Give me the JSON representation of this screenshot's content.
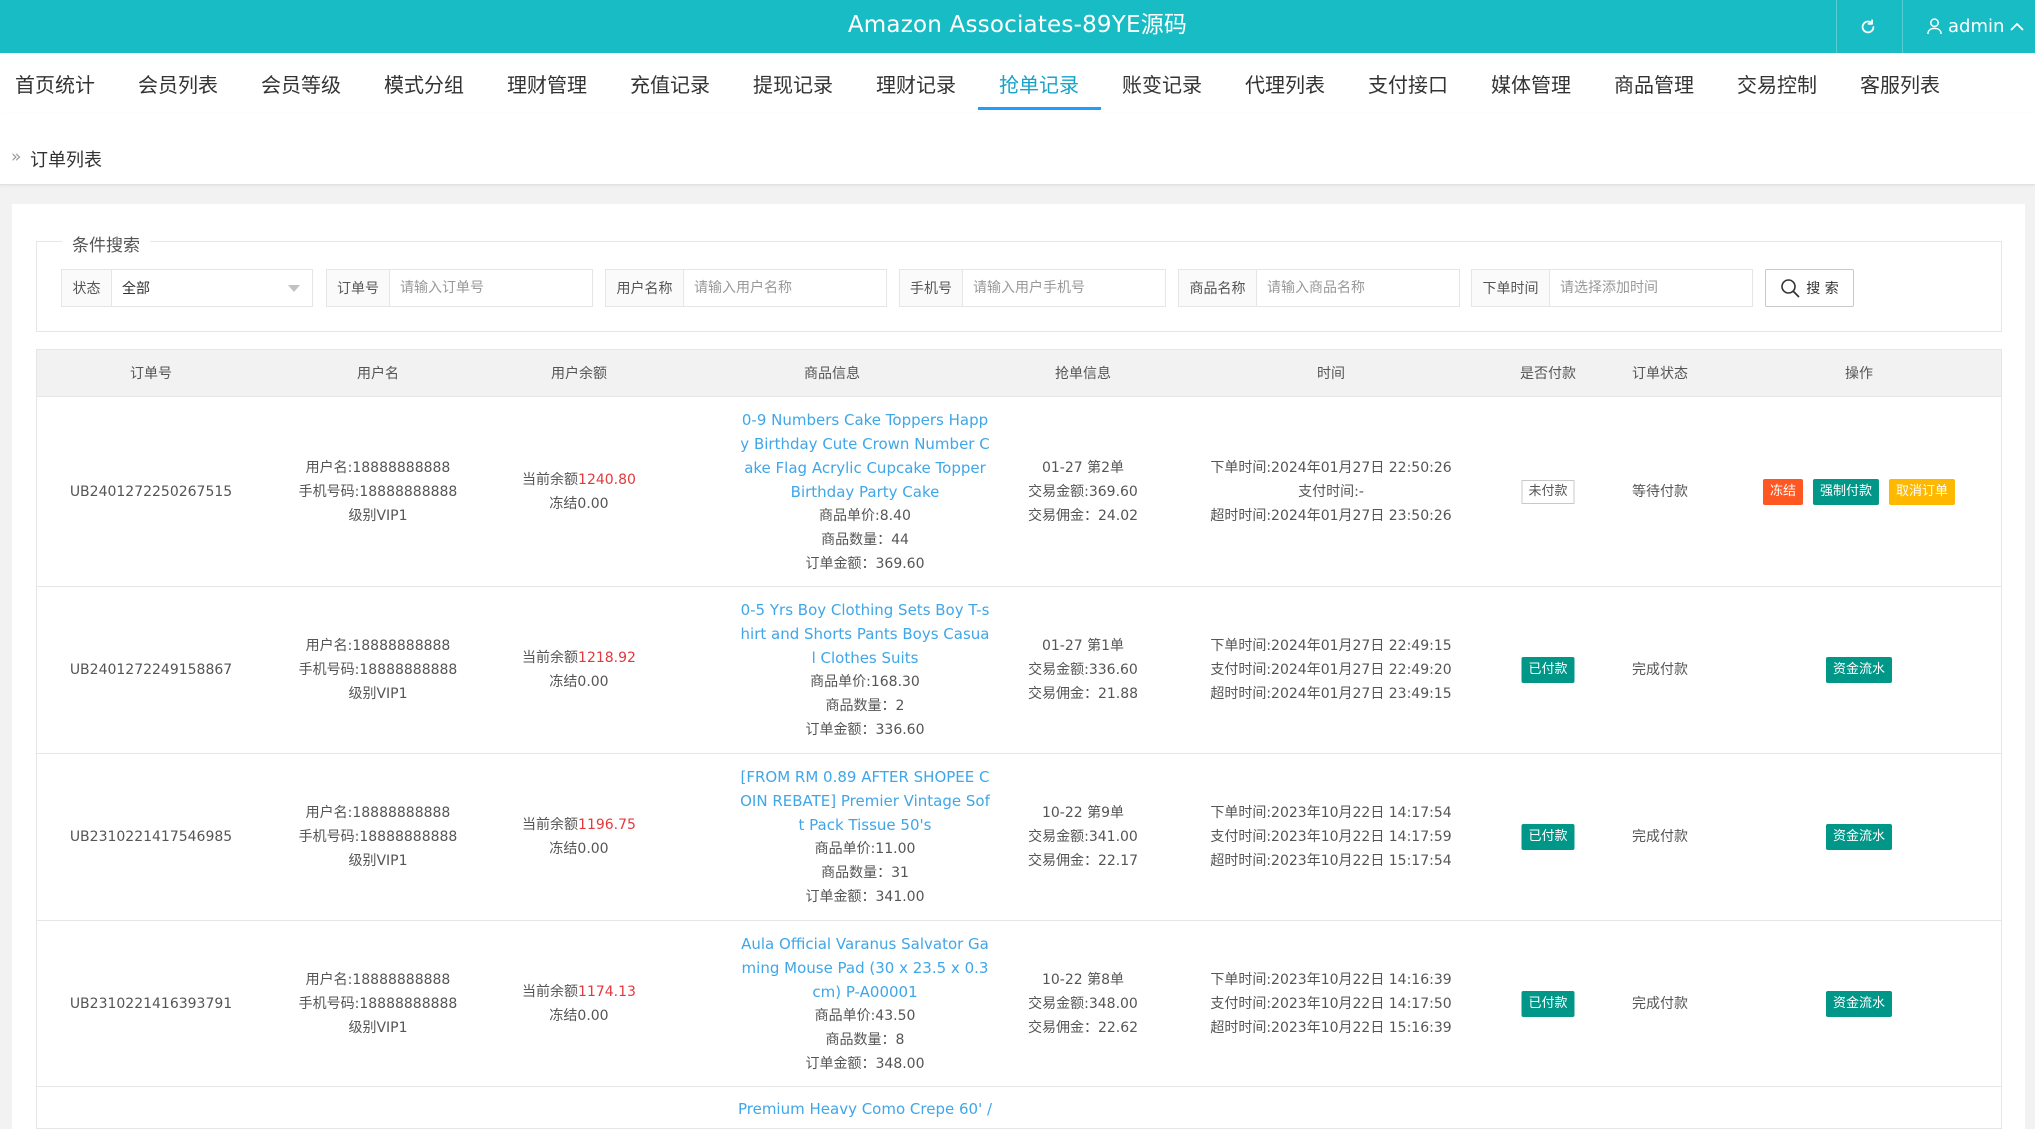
{
  "header": {
    "title": "Amazon Associates-89YE源码",
    "user": "admin",
    "bg": "#17bcc4"
  },
  "nav": {
    "items": [
      "首页统计",
      "会员列表",
      "会员等级",
      "模式分组",
      "理财管理",
      "充值记录",
      "提现记录",
      "理财记录",
      "抢单记录",
      "账变记录",
      "代理列表",
      "支付接口",
      "媒体管理",
      "商品管理",
      "交易控制",
      "客服列表"
    ],
    "active_index": 8
  },
  "breadcrumb": "订单列表",
  "search": {
    "legend": "条件搜索",
    "status_label": "状态",
    "status_value": "全部",
    "order_label": "订单号",
    "order_placeholder": "请输入订单号",
    "username_label": "用户名称",
    "username_placeholder": "请输入用户名称",
    "phone_label": "手机号",
    "phone_placeholder": "请输入用户手机号",
    "goods_label": "商品名称",
    "goods_placeholder": "请输入商品名称",
    "time_label": "下单时间",
    "time_placeholder": "请选择添加时间",
    "button": "搜 索"
  },
  "table": {
    "headers": [
      "订单号",
      "用户名",
      "用户余额",
      "商品信息",
      "抢单信息",
      "时间",
      "是否付款",
      "订单状态",
      "操作"
    ],
    "rows": [
      {
        "order_no": "UB2401272250267515",
        "username": "用户名:18888888888",
        "phone": "手机号码:18888888888",
        "level": "级别VIP1",
        "balance_label": "当前余额",
        "balance": "1240.80",
        "frozen": "冻结0.00",
        "goods_name": "0-9 Numbers Cake Toppers Happy Birthday Cute Crown Number Cake Flag Acrylic Cupcake Topper Birthday Party Cake",
        "unit_price": "商品单价:8.40",
        "qty": "商品数量：44",
        "amount": "订单金额：369.60",
        "grab_date": "01-27 第2单",
        "trade_amount": "交易金额:369.60",
        "commission": "交易佣金：24.02",
        "order_time": "下单时间:2024年01月27日 22:50:26",
        "pay_time": "支付时间:-",
        "timeout_time": "超时时间:2024年01月27日 23:50:26",
        "paid": "未付款",
        "status": "等待付款",
        "actions": [
          "冻结",
          "强制付款",
          "取消订单"
        ]
      },
      {
        "order_no": "UB2401272249158867",
        "username": "用户名:18888888888",
        "phone": "手机号码:18888888888",
        "level": "级别VIP1",
        "balance_label": "当前余额",
        "balance": "1218.92",
        "frozen": "冻结0.00",
        "goods_name": "0-5 Yrs Boy Clothing Sets Boy T-shirt and Shorts Pants Boys Casual Clothes Suits",
        "unit_price": "商品单价:168.30",
        "qty": "商品数量：2",
        "amount": "订单金额：336.60",
        "grab_date": "01-27 第1单",
        "trade_amount": "交易金额:336.60",
        "commission": "交易佣金：21.88",
        "order_time": "下单时间:2024年01月27日 22:49:15",
        "pay_time": "支付时间:2024年01月27日 22:49:20",
        "timeout_time": "超时时间:2024年01月27日 23:49:15",
        "paid": "已付款",
        "status": "完成付款",
        "actions": [
          "资金流水"
        ]
      },
      {
        "order_no": "UB2310221417546985",
        "username": "用户名:18888888888",
        "phone": "手机号码:18888888888",
        "level": "级别VIP1",
        "balance_label": "当前余额",
        "balance": "1196.75",
        "frozen": "冻结0.00",
        "goods_name": "[FROM RM 0.89 AFTER SHOPEE COIN REBATE] Premier Vintage Soft Pack Tissue 50's",
        "unit_price": "商品单价:11.00",
        "qty": "商品数量：31",
        "amount": "订单金额：341.00",
        "grab_date": "10-22 第9单",
        "trade_amount": "交易金额:341.00",
        "commission": "交易佣金：22.17",
        "order_time": "下单时间:2023年10月22日 14:17:54",
        "pay_time": "支付时间:2023年10月22日 14:17:59",
        "timeout_time": "超时时间:2023年10月22日 15:17:54",
        "paid": "已付款",
        "status": "完成付款",
        "actions": [
          "资金流水"
        ]
      },
      {
        "order_no": "UB2310221416393791",
        "username": "用户名:18888888888",
        "phone": "手机号码:18888888888",
        "level": "级别VIP1",
        "balance_label": "当前余额",
        "balance": "1174.13",
        "frozen": "冻结0.00",
        "goods_name": "Aula Official Varanus Salvator Gaming Mouse Pad (30 x 23.5 x 0.3cm) P-A00001",
        "unit_price": "商品单价:43.50",
        "qty": "商品数量：8",
        "amount": "订单金额：348.00",
        "grab_date": "10-22 第8单",
        "trade_amount": "交易金额:348.00",
        "commission": "交易佣金：22.62",
        "order_time": "下单时间:2023年10月22日 14:16:39",
        "pay_time": "支付时间:2023年10月22日 14:17:50",
        "timeout_time": "超时时间:2023年10月22日 15:16:39",
        "paid": "已付款",
        "status": "完成付款",
        "actions": [
          "资金流水"
        ]
      },
      {
        "goods_name": "Premium Heavy Como Crepe 60' /"
      }
    ]
  }
}
